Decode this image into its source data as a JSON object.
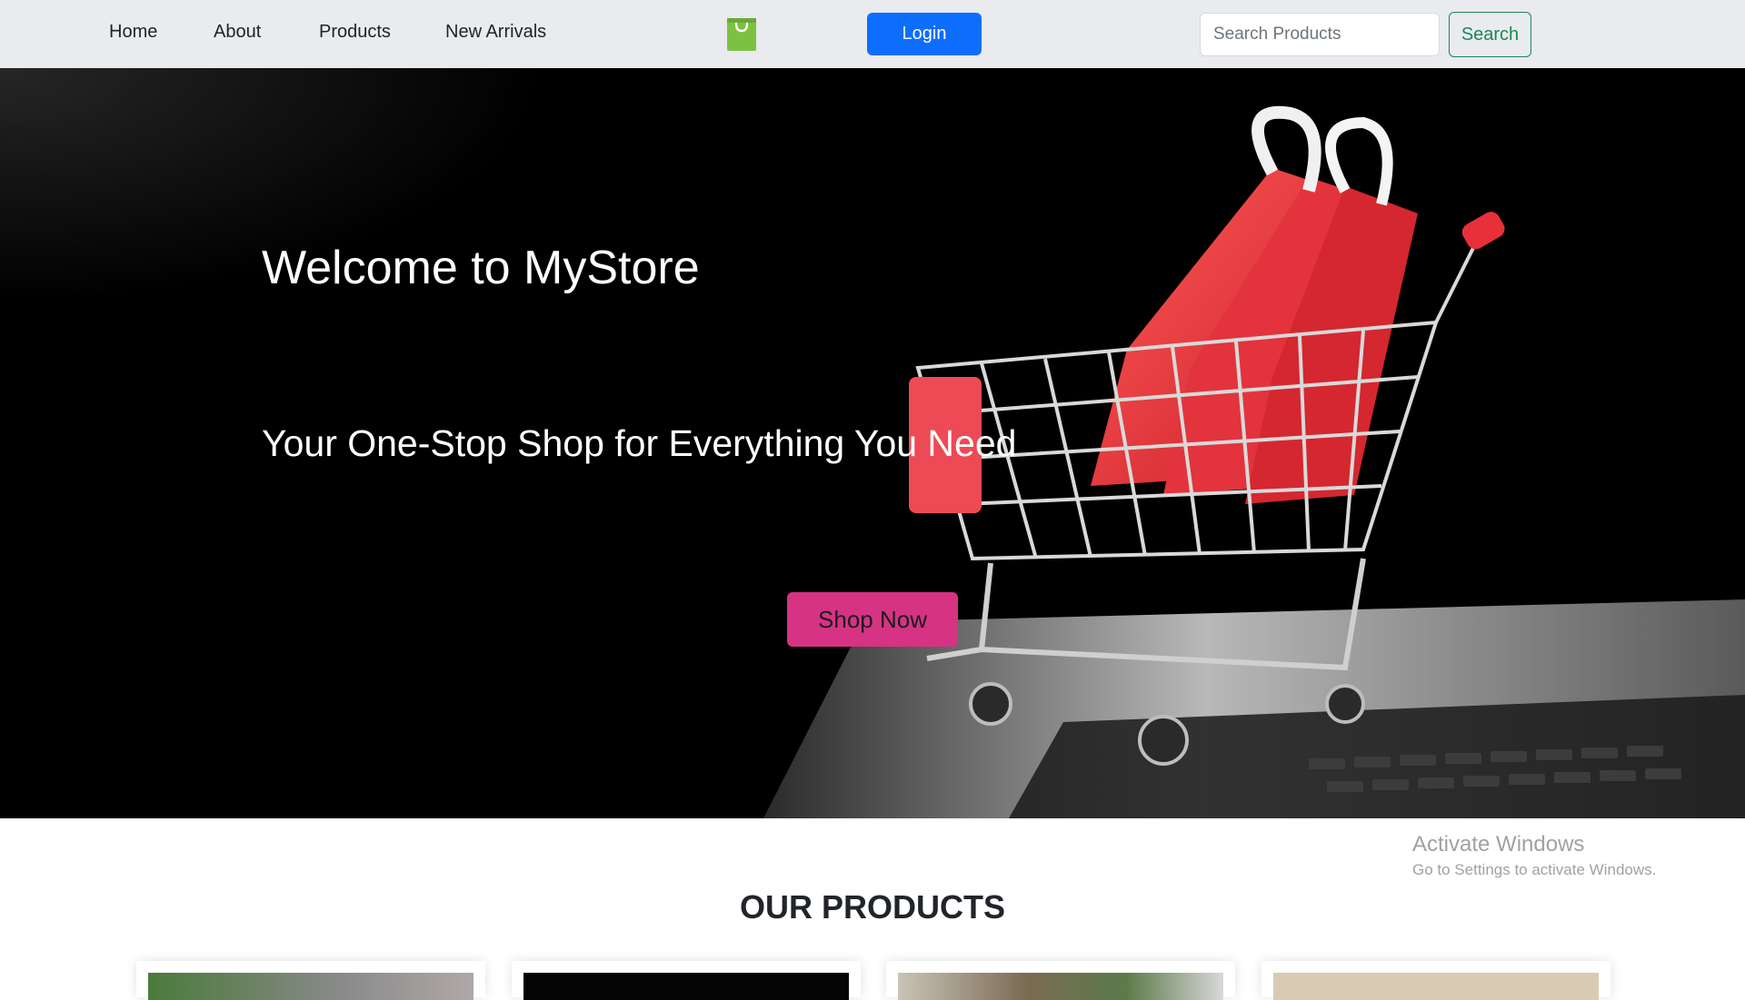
{
  "navbar": {
    "links": [
      "Home",
      "About",
      "Products",
      "New Arrivals"
    ],
    "logo_icon": "shopping-bag-icon",
    "login_label": "Login",
    "search_placeholder": "Search Products",
    "search_value": "",
    "search_label": "Search"
  },
  "hero": {
    "title": "Welcome to MyStore",
    "subtitle": "Your One-Stop Shop for Everything You Need",
    "cta_label": "Shop Now"
  },
  "products": {
    "heading": "OUR PRODUCTS",
    "cards": [
      {
        "image_icon": "product-image"
      },
      {
        "image_icon": "product-image"
      },
      {
        "image_icon": "product-image"
      },
      {
        "image_icon": "product-image"
      }
    ]
  },
  "watermark": {
    "title": "Activate Windows",
    "subtitle": "Go to Settings to activate Windows."
  },
  "colors": {
    "navbar_bg": "#e9ebee",
    "login_bg": "#0d6efd",
    "search_outline": "#198754",
    "cta_bg": "#d63384",
    "logo_green": "#7cc242",
    "cart_red": "#e8303a"
  }
}
